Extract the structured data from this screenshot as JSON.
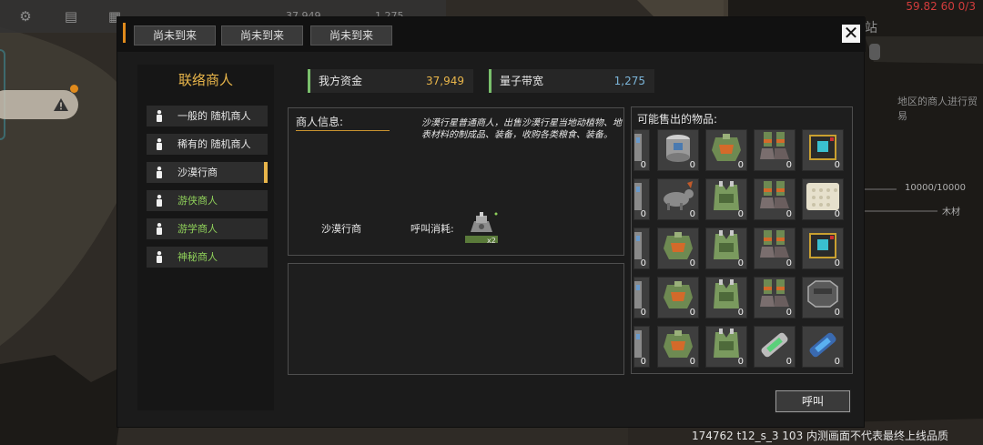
{
  "hud": {
    "top_values": [
      "37,949",
      "1,275"
    ],
    "fps_text": "59.82 60 0/3",
    "build_text": "174762 t12_s_3 103  内测画面不代表最终上线品质",
    "side_texts": [
      "地区的商人进行贸易",
      "10000/10000",
      "木材",
      "站"
    ]
  },
  "tabs": [
    "尚未到来",
    "尚未到来",
    "尚未到来"
  ],
  "trader_list": {
    "title": "联络商人",
    "items": [
      {
        "label": "一般的 随机商人",
        "color": "white"
      },
      {
        "label": "稀有的 随机商人",
        "color": "white"
      },
      {
        "label": "沙漠行商",
        "color": "white",
        "selected": true
      },
      {
        "label": "游侠商人",
        "color": "green"
      },
      {
        "label": "游学商人",
        "color": "green"
      },
      {
        "label": "神秘商人",
        "color": "green"
      }
    ]
  },
  "funds": {
    "money_label": "我方资金",
    "money_value": "37,949",
    "money_color": "#e8b54a",
    "bandwidth_label": "量子带宽",
    "bandwidth_value": "1,275",
    "bandwidth_color": "#7bb4d8"
  },
  "info": {
    "heading": "商人信息:",
    "description": "沙漠行星普通商人，出售沙漠行星当地动植物、地表材料的制成品、装备，收购各类粮食、装备。",
    "trader_name": "沙漠行商",
    "cost_label": "呼叫消耗:",
    "cost_multiplier": "x2",
    "cost_icon": "beacon-device-icon"
  },
  "goods": {
    "title": "可能售出的物品:",
    "rows": [
      [
        {
          "icon": "partial-item-icon",
          "count": "0"
        },
        {
          "icon": "barrel-container-icon",
          "count": "0"
        },
        {
          "icon": "armor-helmet-icon",
          "count": "0"
        },
        {
          "icon": "boots-icon",
          "count": "0"
        },
        {
          "icon": "circuit-chip-icon",
          "count": "0"
        }
      ],
      [
        {
          "icon": "partial-item-icon",
          "count": "0"
        },
        {
          "icon": "creature-icon",
          "count": "0"
        },
        {
          "icon": "armor-vest-icon",
          "count": "0"
        },
        {
          "icon": "boots-icon",
          "count": "0"
        },
        {
          "icon": "cloth-panel-icon",
          "count": "0"
        }
      ],
      [
        {
          "icon": "partial-item-icon",
          "count": "0"
        },
        {
          "icon": "armor-helmet-icon",
          "count": "0"
        },
        {
          "icon": "armor-vest-icon",
          "count": "0"
        },
        {
          "icon": "boots-icon",
          "count": "0"
        },
        {
          "icon": "circuit-chip-icon",
          "count": "0"
        }
      ],
      [
        {
          "icon": "partial-item-icon",
          "count": "0"
        },
        {
          "icon": "armor-helmet-icon",
          "count": "0"
        },
        {
          "icon": "armor-vest-icon",
          "count": "0"
        },
        {
          "icon": "boots-icon",
          "count": "0"
        },
        {
          "icon": "metal-plate-icon",
          "count": "0"
        }
      ],
      [
        {
          "icon": "partial-item-icon",
          "count": "0"
        },
        {
          "icon": "armor-helmet-icon",
          "count": "0"
        },
        {
          "icon": "armor-vest-icon",
          "count": "0"
        },
        {
          "icon": "green-capsule-icon",
          "count": "0"
        },
        {
          "icon": "blue-capsule-icon",
          "count": "0"
        }
      ]
    ]
  },
  "call_button": "呼叫",
  "close_icon": "close-icon"
}
